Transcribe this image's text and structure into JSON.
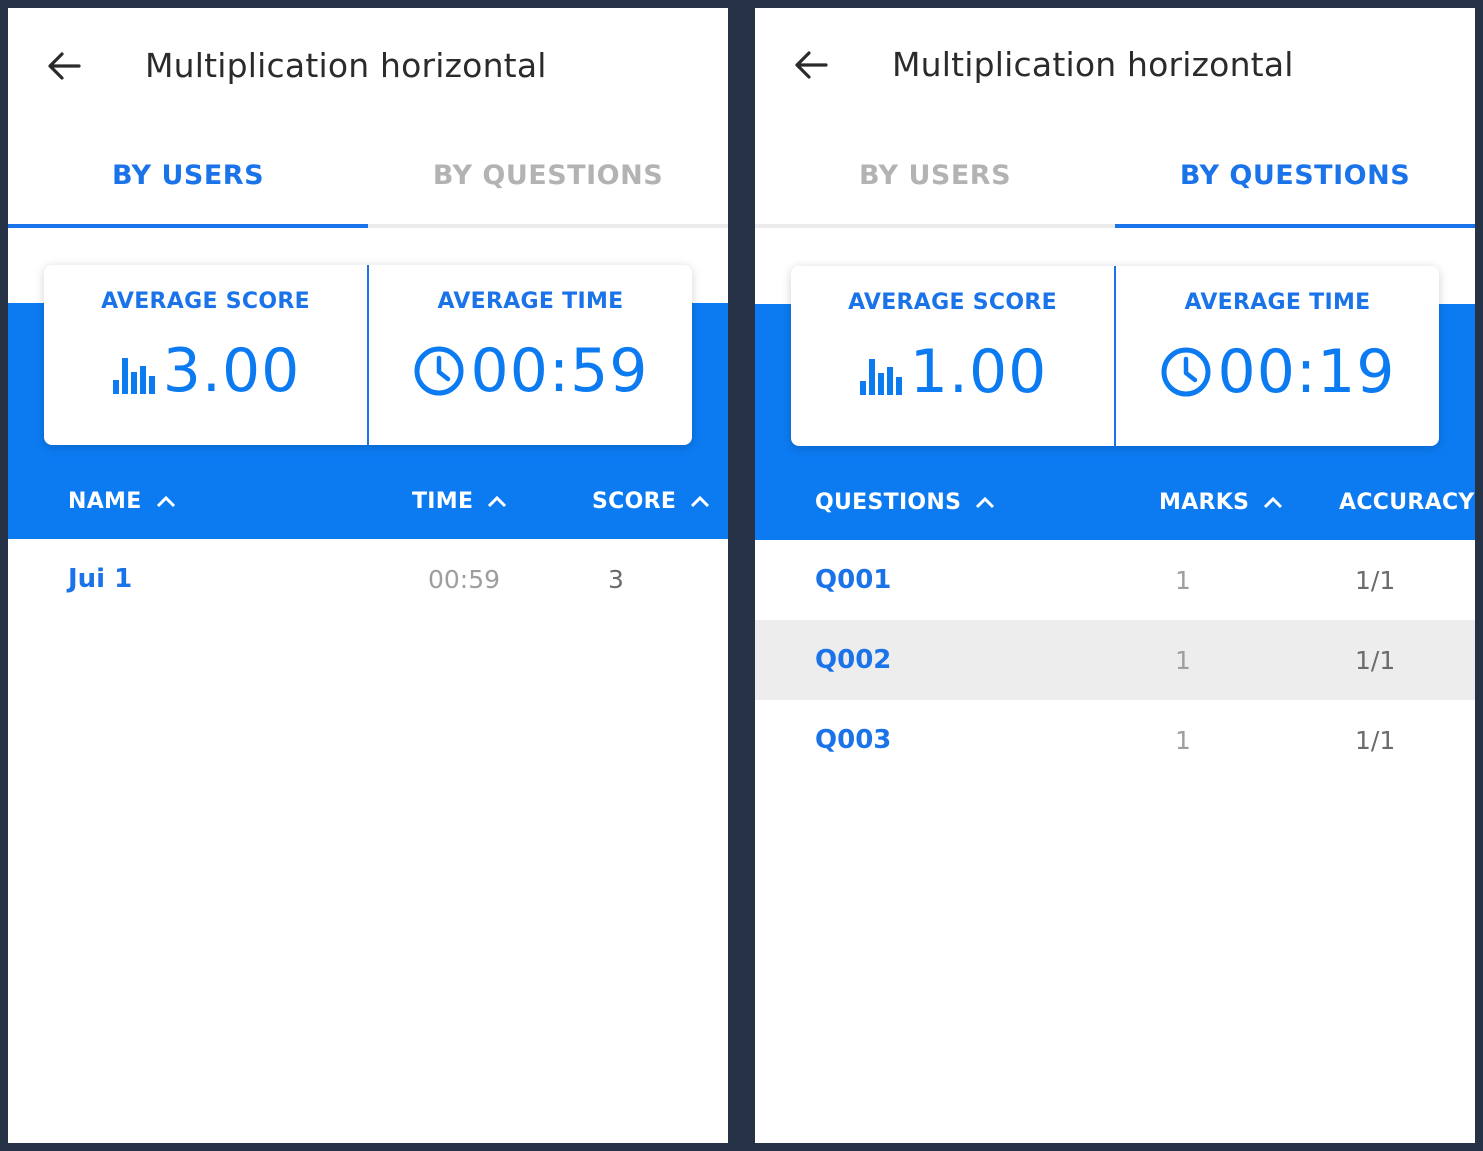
{
  "left": {
    "title": "Multiplication horizontal",
    "tabs": [
      {
        "label": "BY USERS",
        "active": true
      },
      {
        "label": "BY QUESTIONS",
        "active": false
      }
    ],
    "stats": {
      "score_label": "AVERAGE SCORE",
      "score_value": "3.00",
      "time_label": "AVERAGE TIME",
      "time_value": "00:59"
    },
    "columns": [
      "NAME",
      "TIME",
      "SCORE"
    ],
    "rows": [
      {
        "name": "Jui 1",
        "time": "00:59",
        "score": "3"
      }
    ]
  },
  "right": {
    "title": "Multiplication horizontal",
    "tabs": [
      {
        "label": "BY USERS",
        "active": false
      },
      {
        "label": "BY QUESTIONS",
        "active": true
      }
    ],
    "stats": {
      "score_label": "AVERAGE SCORE",
      "score_value": "1.00",
      "time_label": "AVERAGE TIME",
      "time_value": "00:19"
    },
    "columns": [
      "QUESTIONS",
      "MARKS",
      "ACCURACY"
    ],
    "rows": [
      {
        "question": "Q001",
        "marks": "1",
        "accuracy": "1/1"
      },
      {
        "question": "Q002",
        "marks": "1",
        "accuracy": "1/1"
      },
      {
        "question": "Q003",
        "marks": "1",
        "accuracy": "1/1"
      }
    ]
  },
  "colors": {
    "accent": "#1a73e8",
    "band": "#0c7bf2",
    "frame": "#263347",
    "inactive_tab": "#b3b3b3",
    "row_highlight": "#ededed"
  },
  "icons": [
    "arrow-back-icon",
    "bar-chart-icon",
    "clock-icon",
    "chevron-up-icon"
  ]
}
